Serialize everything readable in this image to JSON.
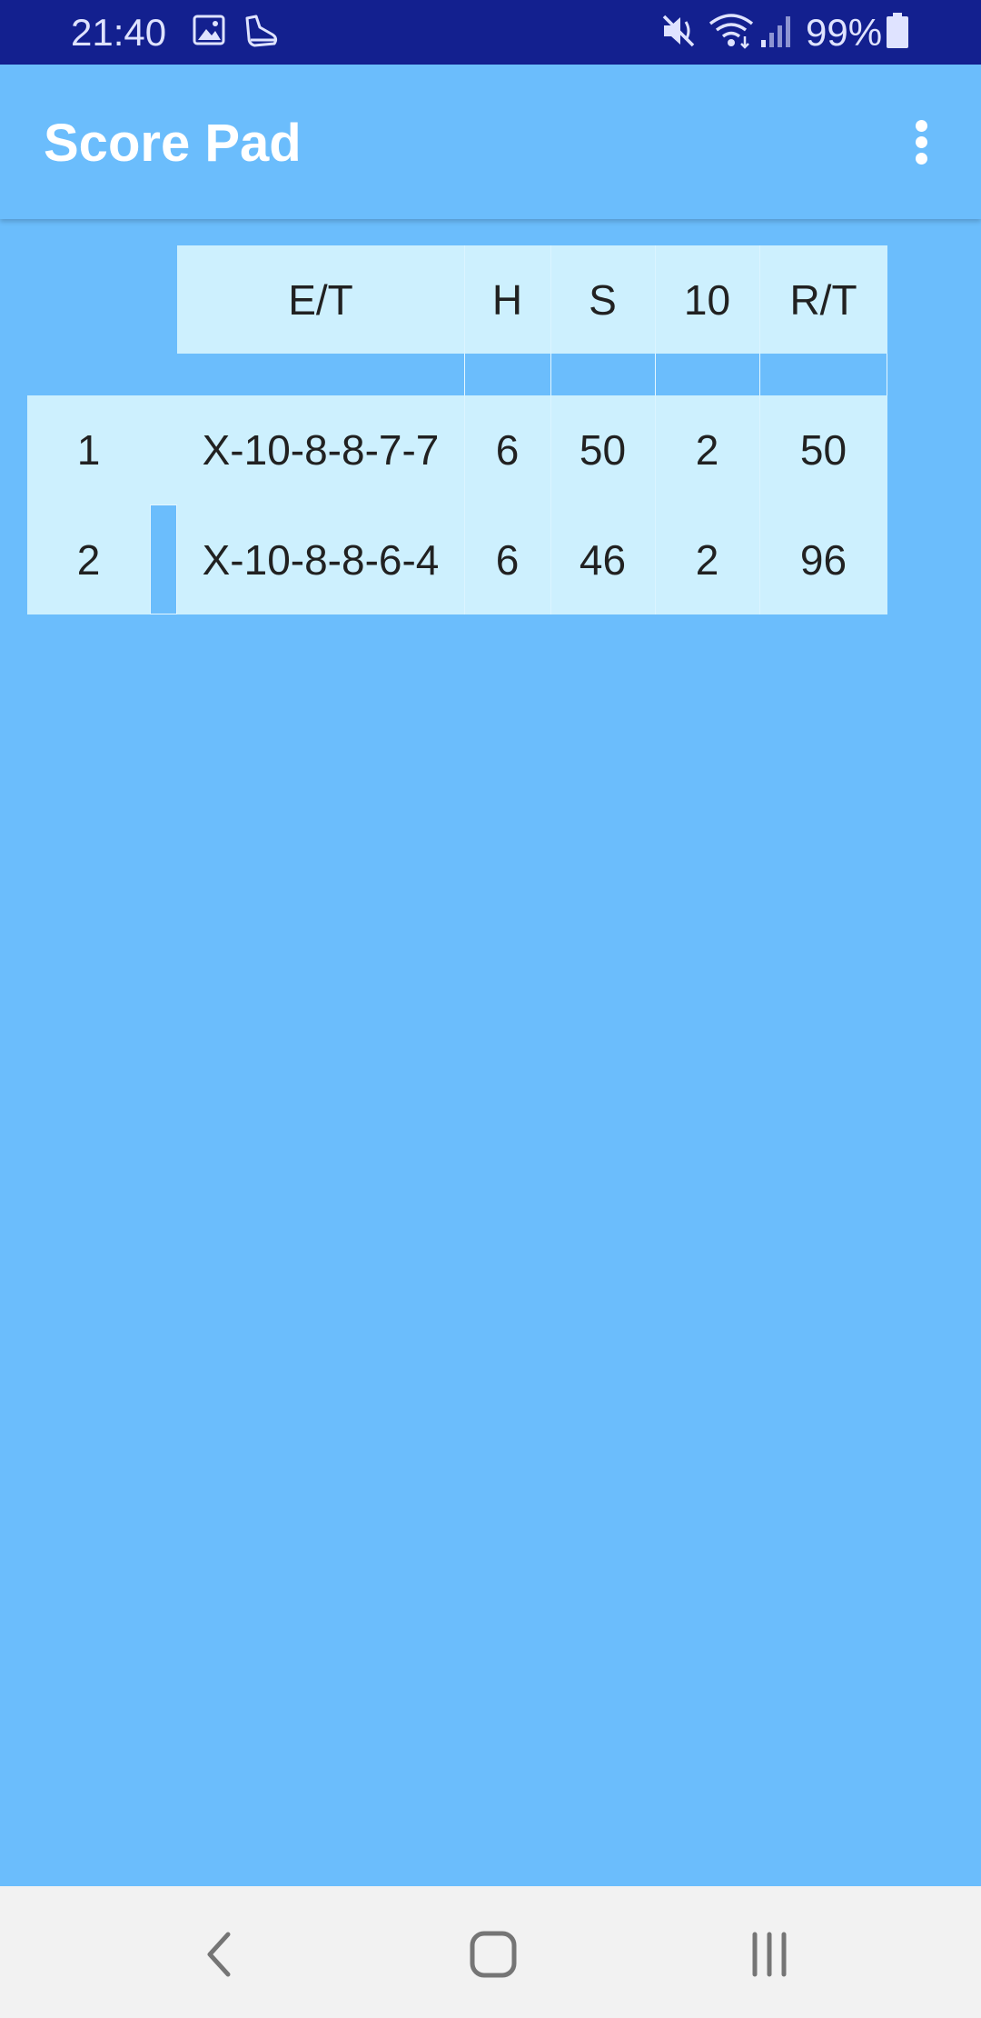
{
  "status_bar": {
    "time": "21:40",
    "battery": "99%",
    "icons": [
      "image-icon",
      "shoe-icon",
      "mute-icon",
      "wifi-icon",
      "signal-icon",
      "battery-icon"
    ]
  },
  "app_bar": {
    "title": "Score Pad",
    "menu_icon": "more-vert-icon"
  },
  "score_table": {
    "headers": [
      "E/T",
      "H",
      "S",
      "10",
      "R/T"
    ],
    "rows": [
      {
        "number": "1",
        "et": "X-10-8-8-7-7",
        "h": "6",
        "s": "50",
        "tens": "2",
        "rt": "50"
      },
      {
        "number": "2",
        "et": "X-10-8-8-6-4",
        "h": "6",
        "s": "46",
        "tens": "2",
        "rt": "96"
      }
    ]
  },
  "nav_bar": {
    "icons": [
      "back-icon",
      "home-icon",
      "recents-icon"
    ]
  },
  "colors": {
    "status_bar": "#13208f",
    "background": "#6bbdfc",
    "cell": "#cdf0fe",
    "nav_bar": "#f2f2f2"
  }
}
